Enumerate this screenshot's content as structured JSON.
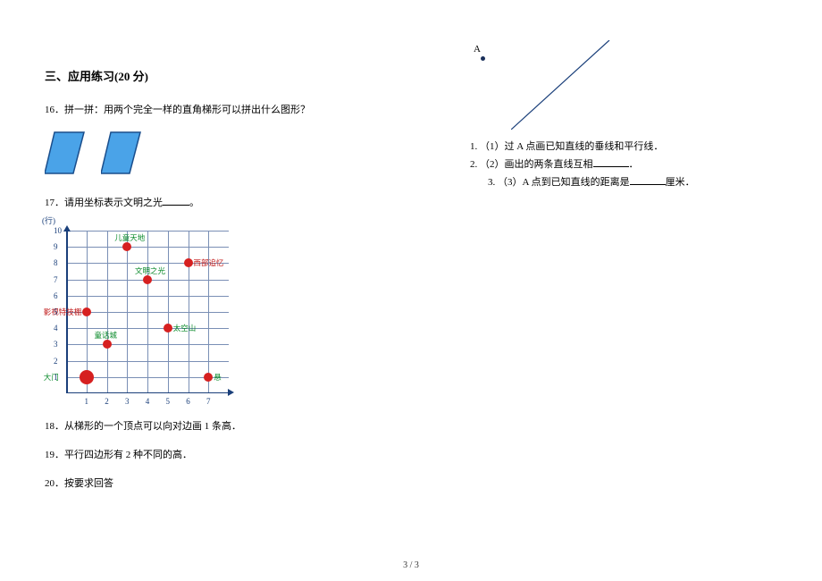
{
  "section": {
    "title": "三、应用练习(20 分)"
  },
  "q16": {
    "num": "16．",
    "text": "拼一拼：用两个完全一样的直角梯形可以拼出什么图形？"
  },
  "q17": {
    "num": "17．",
    "text_a": "请用坐标表示文明之光",
    "text_b": "。"
  },
  "q18": {
    "num": "18．",
    "text": "从梯形的一个顶点可以向对边画 1 条高．"
  },
  "q19": {
    "num": "19．",
    "text": "平行四边形有 2 种不同的高．"
  },
  "q20": {
    "num": "20．",
    "text": "按要求回答",
    "pointA": "A",
    "sub1_num": "1.",
    "sub1_text": "（1）过 A 点画已知直线的垂线和平行线．",
    "sub2_num": "2.",
    "sub2_text_a": "（2）画出的两条直线互相",
    "sub2_text_b": "．",
    "sub3_num": "3.",
    "sub3_text_a": "（3）A 点到已知直线的距离是",
    "sub3_text_b": "厘米．"
  },
  "page_number": "3 / 3",
  "chart_data": {
    "type": "scatter",
    "title": "",
    "xlabel": "",
    "ylabel": "(行)",
    "xlim": [
      0,
      8
    ],
    "ylim": [
      0,
      10
    ],
    "xticks": [
      1,
      2,
      3,
      4,
      5,
      6,
      7
    ],
    "yticks": [
      1,
      2,
      3,
      4,
      5,
      6,
      7,
      8,
      9,
      10
    ],
    "series": [
      {
        "name": "大门",
        "label_color": "green",
        "x": 1,
        "y": 1
      },
      {
        "name": "影视特技棚",
        "label_color": "red",
        "x": 1,
        "y": 5
      },
      {
        "name": "童话城",
        "label_color": "green",
        "x": 2,
        "y": 3
      },
      {
        "name": "儿童天地",
        "label_color": "green",
        "x": 3,
        "y": 9
      },
      {
        "name": "文明之光",
        "label_color": "green",
        "x": 4,
        "y": 7
      },
      {
        "name": "太空山",
        "label_color": "green",
        "x": 5,
        "y": 4
      },
      {
        "name": "西部追忆",
        "label_color": "red",
        "x": 6,
        "y": 8
      },
      {
        "name": "悬",
        "label_color": "green",
        "x": 7,
        "y": 1
      }
    ]
  }
}
